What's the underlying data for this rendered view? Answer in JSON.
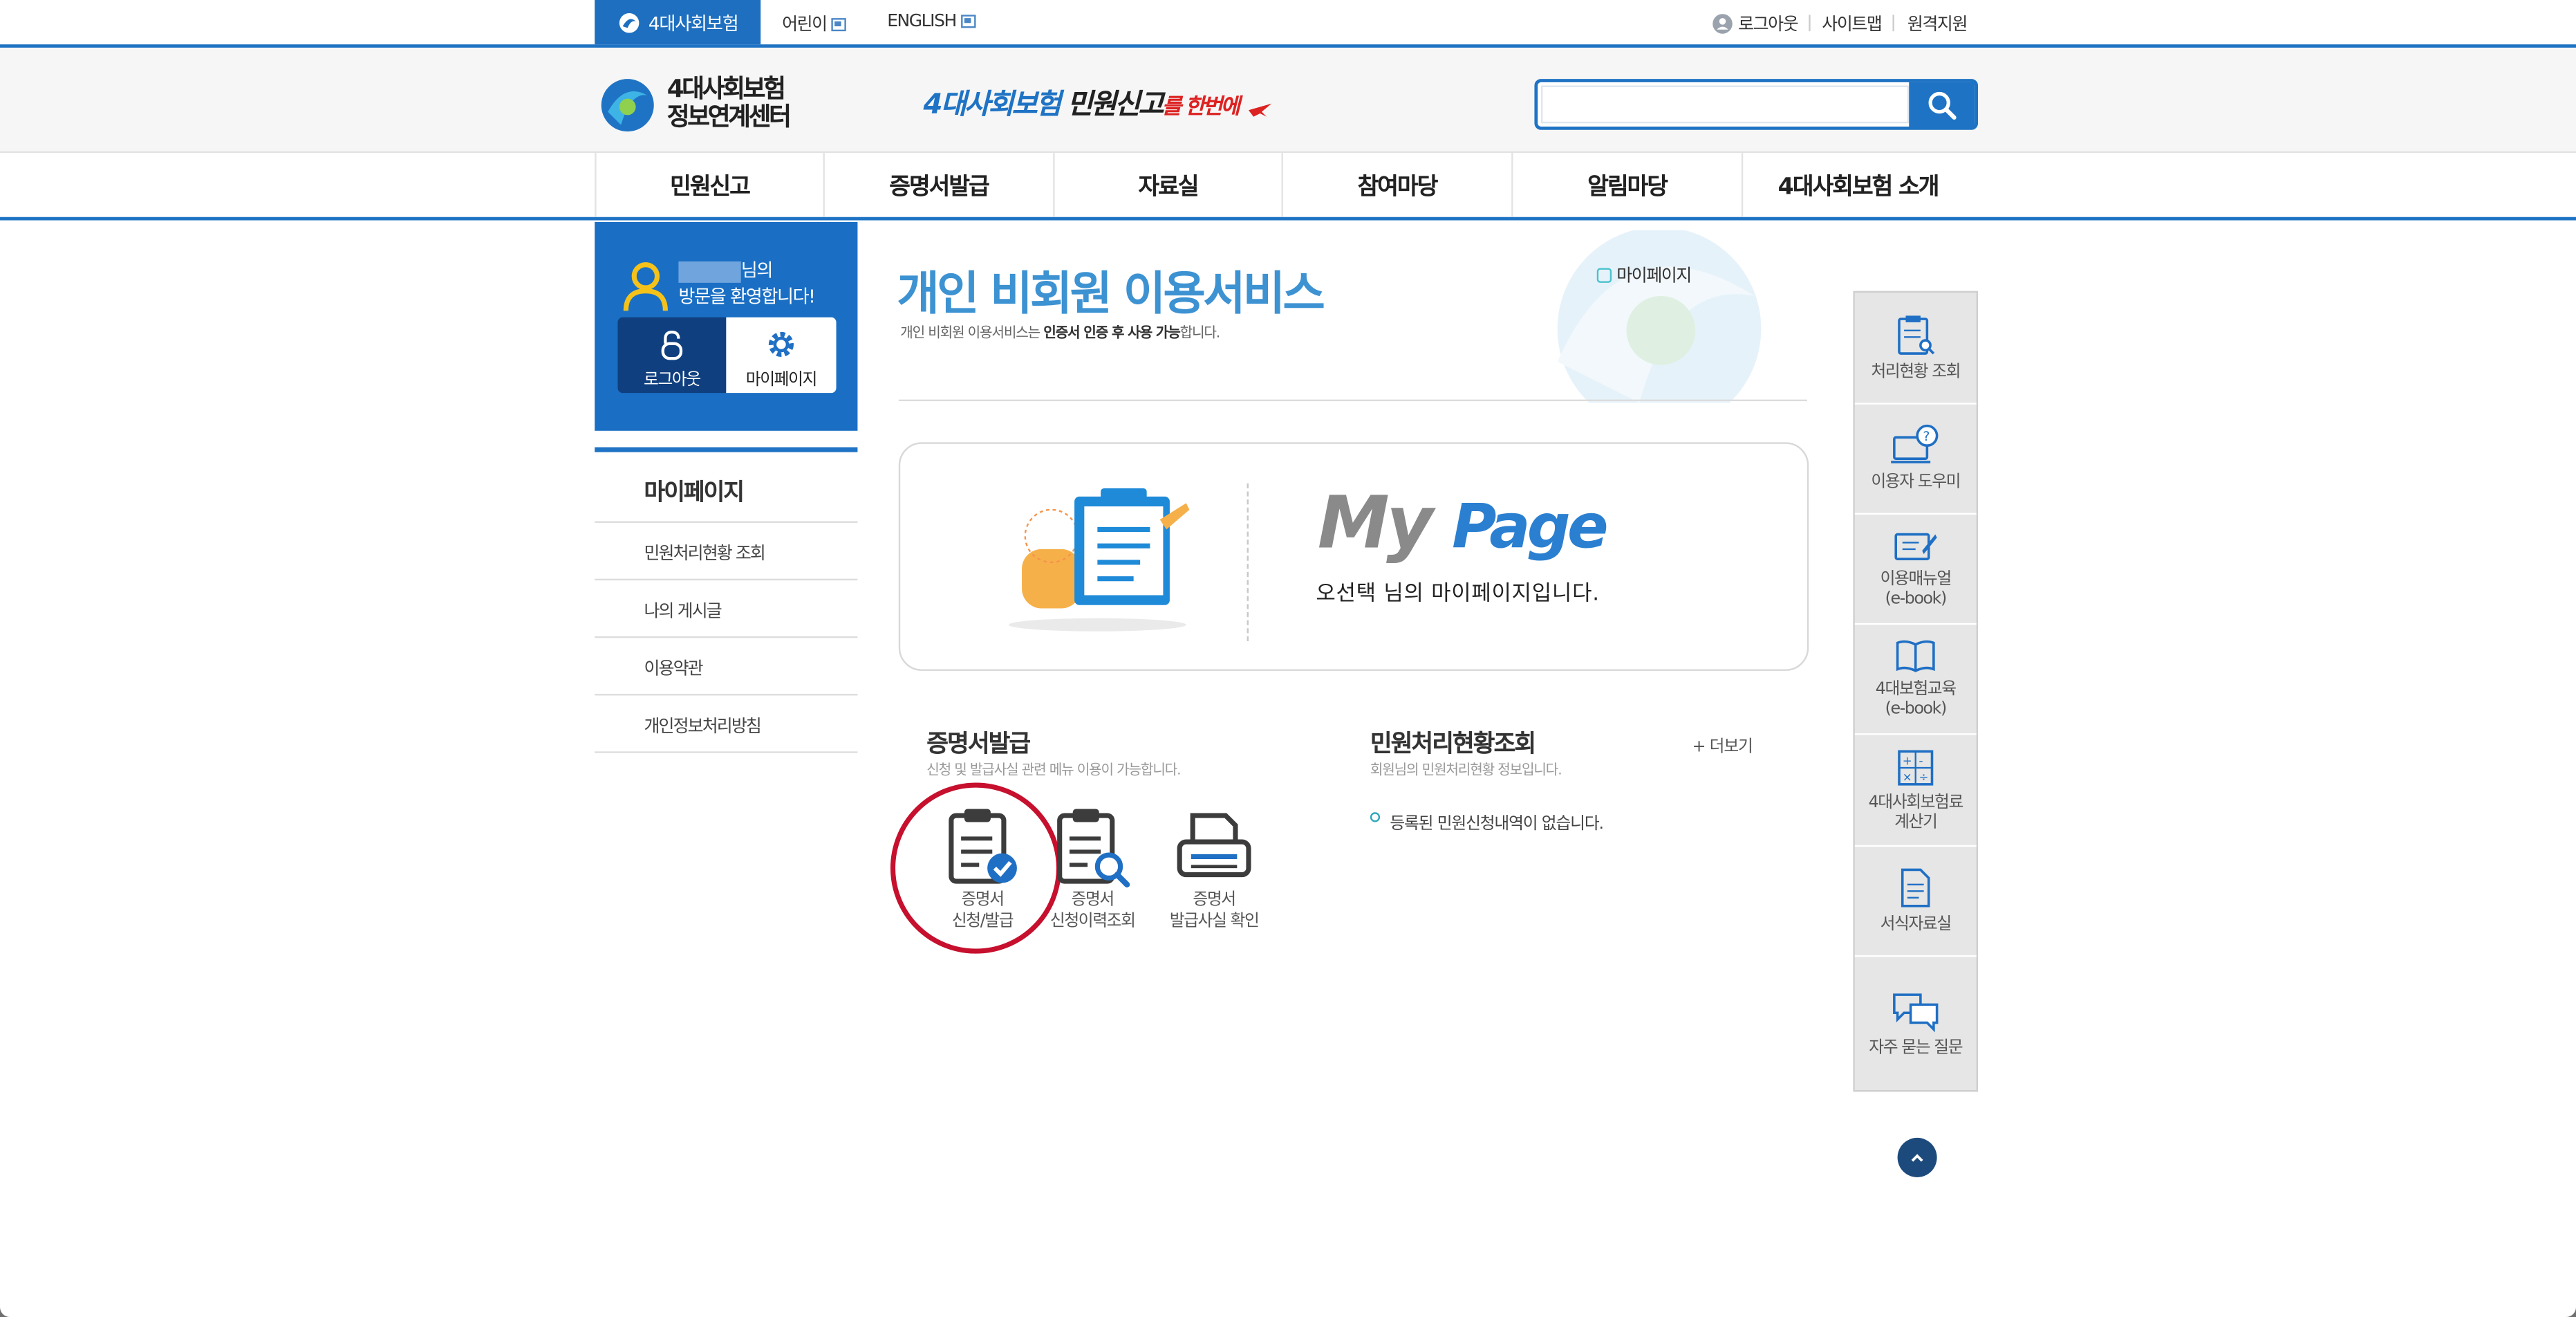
{
  "util_bar": {
    "main_tab": "4대사회보험",
    "kids": "어린이",
    "english": "ENGLISH",
    "logout": "로그아웃",
    "sitemap": "사이트맵",
    "remote": "원격지원"
  },
  "header": {
    "logo_line1": "4대사회보험",
    "logo_line2": "정보연계센터",
    "slogan_a": "4대사회보험",
    "slogan_b": "민원신고",
    "slogan_c": "를 한번에",
    "search_placeholder": ""
  },
  "gnb": [
    "민원신고",
    "증명서발급",
    "자료실",
    "참여마당",
    "알림마당",
    "4대사회보험 소개"
  ],
  "welcome": {
    "line1_suffix": "님의",
    "line2": "방문을 환영합니다!",
    "logout_btn": "로그아웃",
    "mypage_btn": "마이페이지"
  },
  "lnb": {
    "title": "마이페이지",
    "items": [
      "민원처리현황 조회",
      "나의 게시글",
      "이용약관",
      "개인정보처리방침"
    ]
  },
  "content": {
    "title": "개인 비회원 이용서비스",
    "subtitle_pre": "개인 비회원 이용서비스는 ",
    "subtitle_bold": "인증서 인증 후 사용 가능",
    "subtitle_post": "합니다.",
    "breadcrumb": "마이페이지",
    "my": "My",
    "page": "Page",
    "mypage_msg": "오선택 님의 마이페이지입니다."
  },
  "cert": {
    "title": "증명서발급",
    "subtitle": "신청 및 발급사실 관련 메뉴 이용이 가능합니다.",
    "items": [
      {
        "line1": "증명서",
        "line2": "신청/발급"
      },
      {
        "line1": "증명서",
        "line2": "신청이력조회"
      },
      {
        "line1": "증명서",
        "line2": "발급사실 확인"
      }
    ]
  },
  "status": {
    "title": "민원처리현황조회",
    "subtitle": "회원님의 민원처리현황 정보입니다.",
    "more": "+ 더보기",
    "empty": "등록된 민원신청내역이 없습니다."
  },
  "quick": [
    {
      "line1": "처리현황 조회",
      "line2": ""
    },
    {
      "line1": "이용자 도우미",
      "line2": ""
    },
    {
      "line1": "이용매뉴얼",
      "line2": "(e-book)"
    },
    {
      "line1": "4대보험교육",
      "line2": "(e-book)"
    },
    {
      "line1": "4대사회보험료",
      "line2": "계산기"
    },
    {
      "line1": "서식자료실",
      "line2": ""
    },
    {
      "line1": "자주 묻는 질문",
      "line2": ""
    }
  ],
  "colors": {
    "primary": "#1f73c4",
    "dark": "#0f3f7e",
    "title_blue": "#3d92d2",
    "highlight": "#c6102e"
  }
}
